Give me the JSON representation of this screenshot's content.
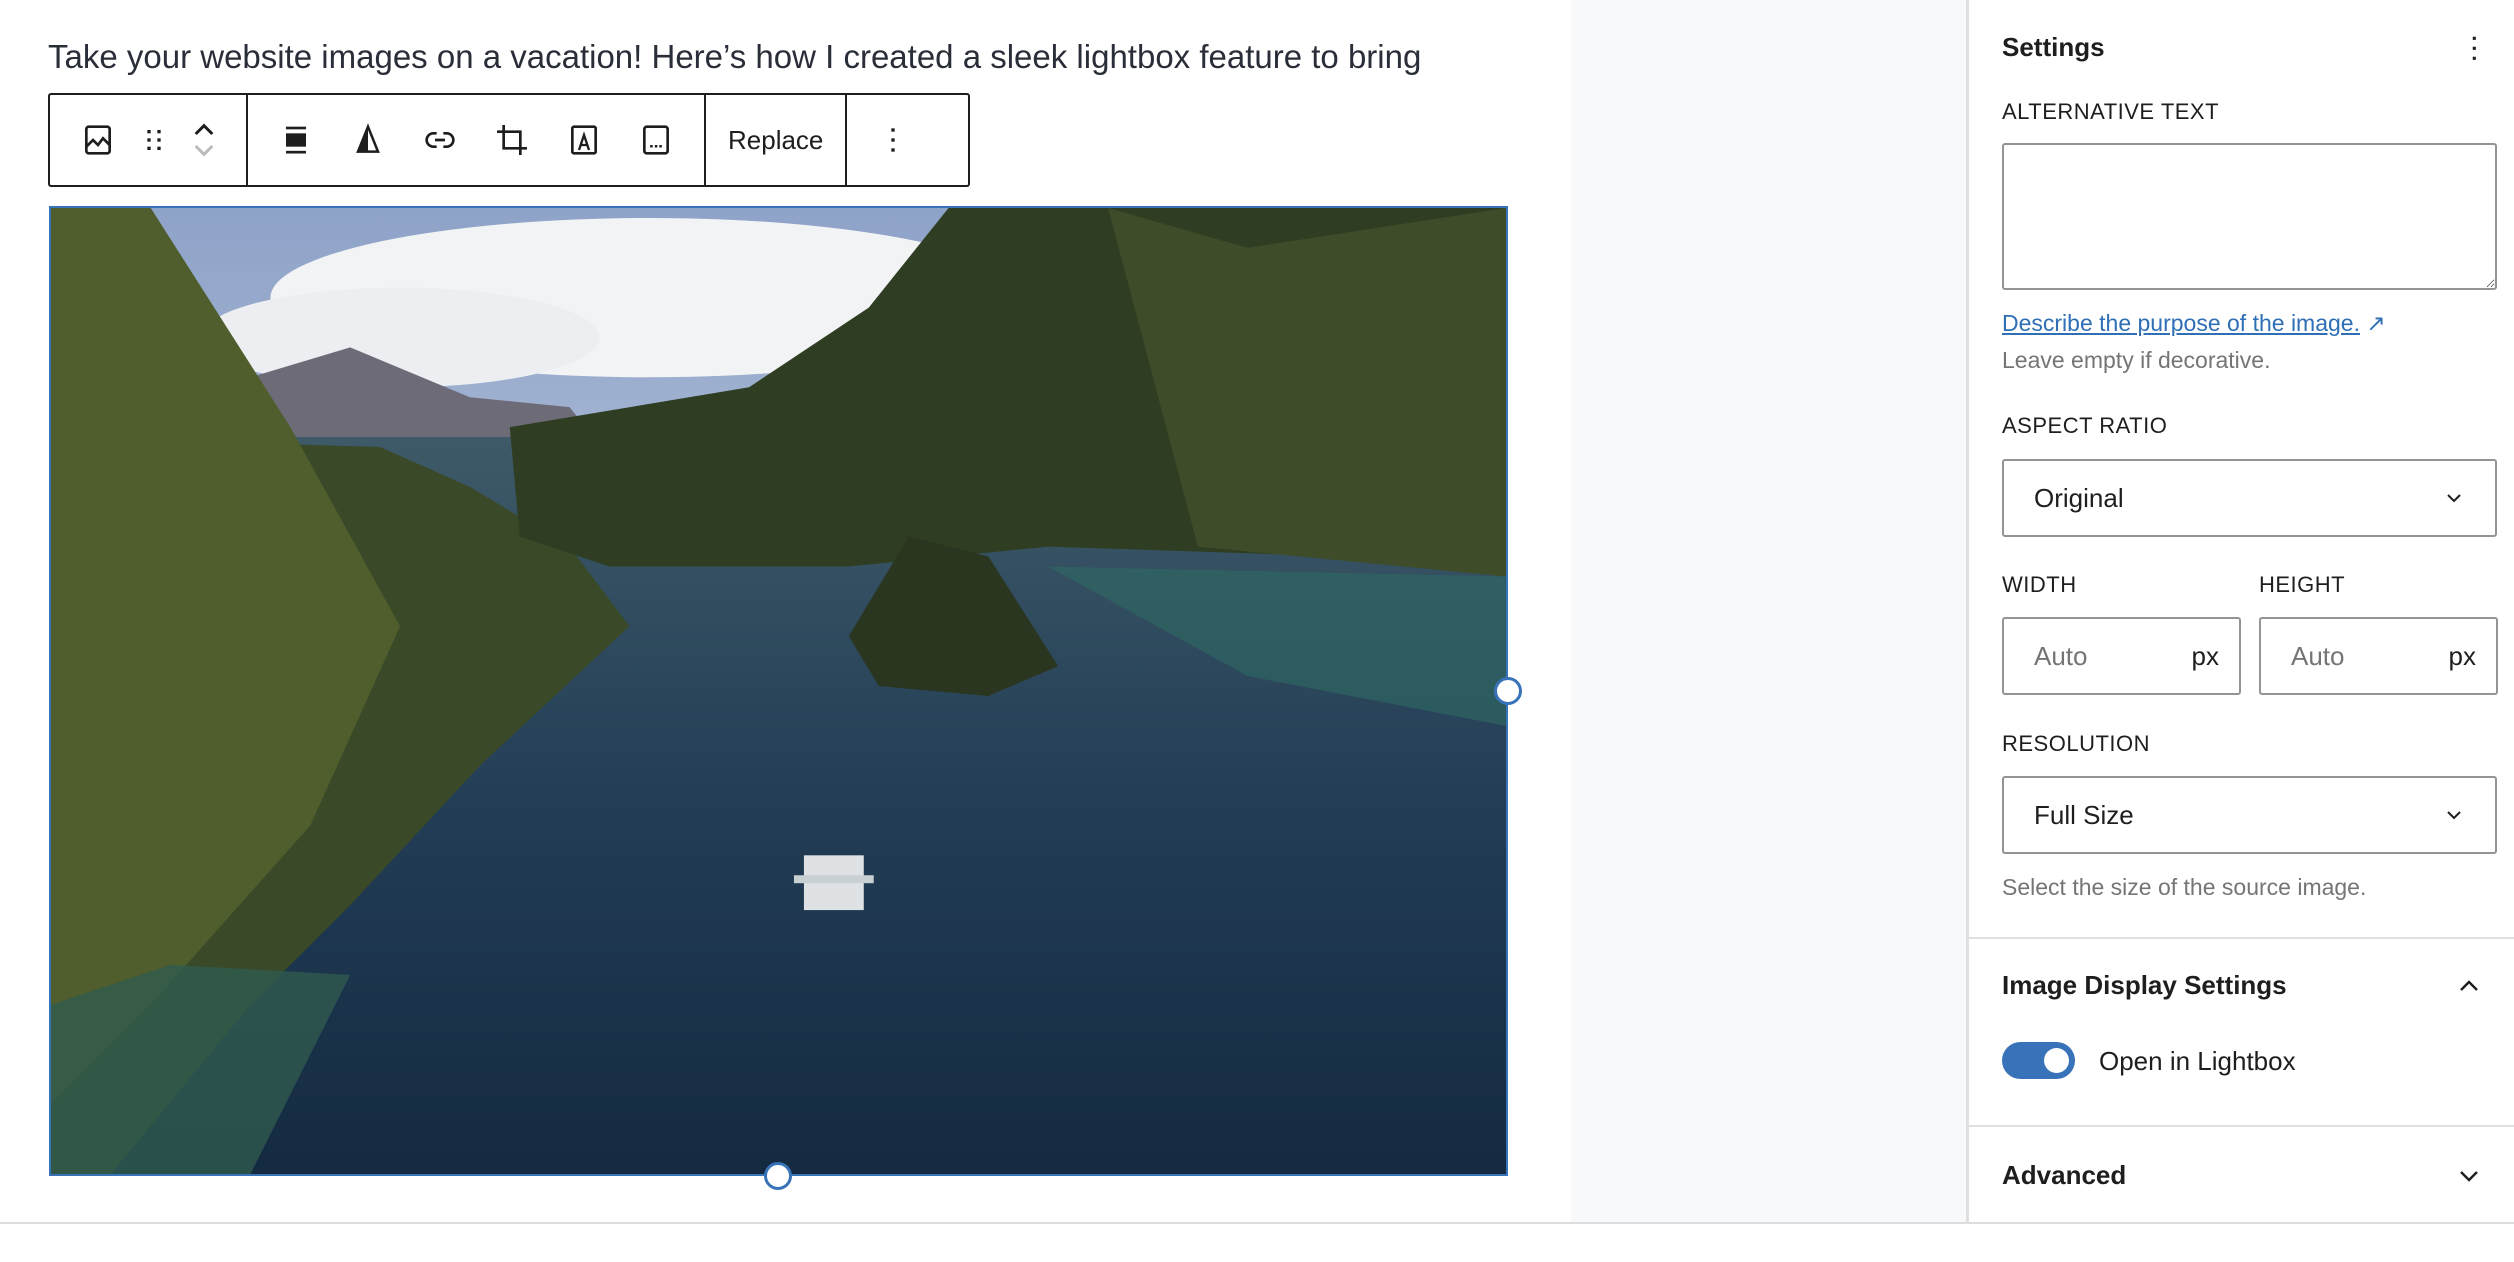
{
  "editor": {
    "title_text": "Take your website images on a vacation! Here’s how I created a sleek lightbox feature to bring",
    "toolbar": {
      "icons": [
        "image-icon",
        "drag-handle-icon",
        "move-up-icon",
        "move-down-icon",
        "align-icon",
        "duotone-icon",
        "link-icon",
        "crop-icon",
        "text-overlay-icon",
        "caption-icon",
        "more-options-icon"
      ],
      "replace_label": "Replace"
    },
    "selection_color": "#3872b8"
  },
  "sidebar": {
    "title": "Settings",
    "alt_text": {
      "label": "ALTERNATIVE TEXT",
      "value": "",
      "link": "Describe the purpose of the image.",
      "link_icon": "↗",
      "help": "Leave empty if decorative."
    },
    "aspect_ratio": {
      "label": "ASPECT RATIO",
      "value": "Original"
    },
    "width": {
      "label": "WIDTH",
      "placeholder": "Auto",
      "unit": "px"
    },
    "height": {
      "label": "HEIGHT",
      "placeholder": "Auto",
      "unit": "px"
    },
    "resolution": {
      "label": "RESOLUTION",
      "value": "Full Size",
      "help": "Select the size of the source image."
    },
    "display_settings": {
      "title": "Image Display Settings",
      "expanded": true,
      "lightbox_label": "Open in Lightbox",
      "lightbox_on": true,
      "toggle_color": "#3872b8"
    },
    "advanced": {
      "title": "Advanced",
      "expanded": false
    },
    "link_color": "#2f6fb5"
  }
}
